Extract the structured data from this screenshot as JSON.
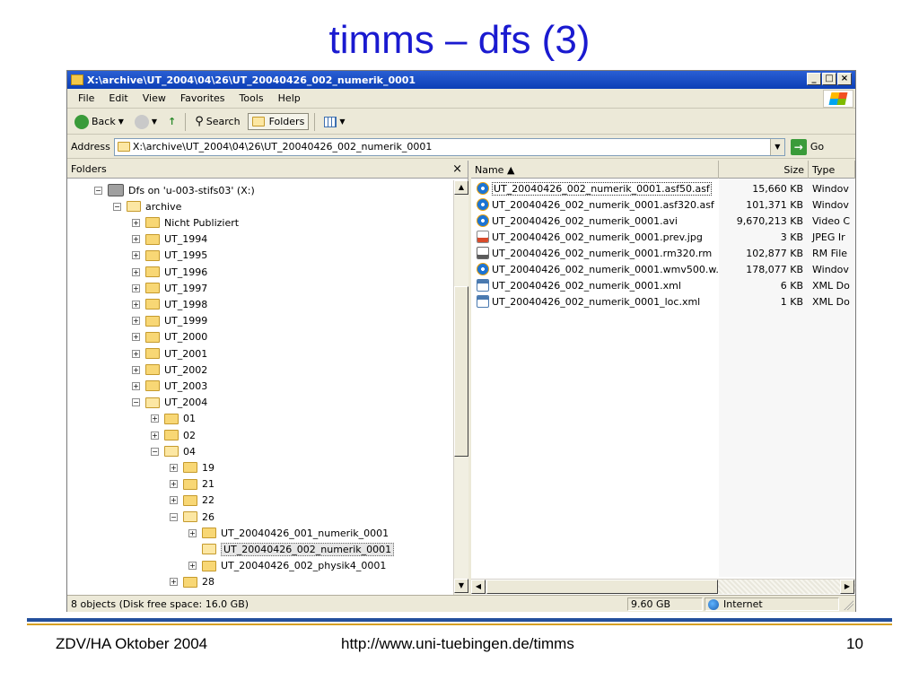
{
  "slide": {
    "title": "timms – dfs (3)",
    "footer_left": "ZDV/HA Oktober 2004",
    "footer_center": "http://www.uni-tuebingen.de/timms",
    "footer_right": "10"
  },
  "window": {
    "title": "X:\\archive\\UT_2004\\04\\26\\UT_20040426_002_numerik_0001",
    "controls": {
      "minimize": "_",
      "maximize": "□",
      "close": "×"
    }
  },
  "menu": [
    "File",
    "Edit",
    "View",
    "Favorites",
    "Tools",
    "Help"
  ],
  "toolbar": {
    "back": "Back",
    "search": "Search",
    "folders": "Folders"
  },
  "address": {
    "label": "Address",
    "value": "X:\\archive\\UT_2004\\04\\26\\UT_20040426_002_numerik_0001",
    "go": "Go"
  },
  "folders_pane": {
    "header": "Folders",
    "close": "×",
    "tree": [
      {
        "label": "Dfs on 'u-003-stifs03' (X:)",
        "level": 0,
        "expander": "−",
        "icon": "network-drive"
      },
      {
        "label": "archive",
        "level": 1,
        "expander": "−",
        "icon": "folder-open"
      },
      {
        "label": "Nicht Publiziert",
        "level": 2,
        "expander": "+",
        "icon": "folder"
      },
      {
        "label": "UT_1994",
        "level": 2,
        "expander": "+",
        "icon": "folder"
      },
      {
        "label": "UT_1995",
        "level": 2,
        "expander": "+",
        "icon": "folder"
      },
      {
        "label": "UT_1996",
        "level": 2,
        "expander": "+",
        "icon": "folder"
      },
      {
        "label": "UT_1997",
        "level": 2,
        "expander": "+",
        "icon": "folder"
      },
      {
        "label": "UT_1998",
        "level": 2,
        "expander": "+",
        "icon": "folder"
      },
      {
        "label": "UT_1999",
        "level": 2,
        "expander": "+",
        "icon": "folder"
      },
      {
        "label": "UT_2000",
        "level": 2,
        "expander": "+",
        "icon": "folder"
      },
      {
        "label": "UT_2001",
        "level": 2,
        "expander": "+",
        "icon": "folder"
      },
      {
        "label": "UT_2002",
        "level": 2,
        "expander": "+",
        "icon": "folder"
      },
      {
        "label": "UT_2003",
        "level": 2,
        "expander": "+",
        "icon": "folder"
      },
      {
        "label": "UT_2004",
        "level": 2,
        "expander": "−",
        "icon": "folder-open"
      },
      {
        "label": "01",
        "level": 3,
        "expander": "+",
        "icon": "folder"
      },
      {
        "label": "02",
        "level": 3,
        "expander": "+",
        "icon": "folder"
      },
      {
        "label": "04",
        "level": 3,
        "expander": "−",
        "icon": "folder-open"
      },
      {
        "label": "19",
        "level": 4,
        "expander": "+",
        "icon": "folder"
      },
      {
        "label": "21",
        "level": 4,
        "expander": "+",
        "icon": "folder"
      },
      {
        "label": "22",
        "level": 4,
        "expander": "+",
        "icon": "folder"
      },
      {
        "label": "26",
        "level": 4,
        "expander": "−",
        "icon": "folder-open"
      },
      {
        "label": "UT_20040426_001_numerik_0001",
        "level": 5,
        "expander": "+",
        "icon": "folder"
      },
      {
        "label": "UT_20040426_002_numerik_0001",
        "level": 5,
        "expander": "",
        "icon": "folder-open",
        "selected": true
      },
      {
        "label": "UT_20040426_002_physik4_0001",
        "level": 5,
        "expander": "+",
        "icon": "folder"
      },
      {
        "label": "28",
        "level": 4,
        "expander": "+",
        "icon": "folder"
      }
    ]
  },
  "files": {
    "columns": {
      "name": "Name ▲",
      "size": "Size",
      "type": "Type"
    },
    "rows": [
      {
        "name": "UT_20040426_002_numerik_0001.asf50.asf",
        "size": "15,660 KB",
        "type": "Windov",
        "icon": "media"
      },
      {
        "name": "UT_20040426_002_numerik_0001.asf320.asf",
        "size": "101,371 KB",
        "type": "Windov",
        "icon": "media"
      },
      {
        "name": "UT_20040426_002_numerik_0001.avi",
        "size": "9,670,213 KB",
        "type": "Video C",
        "icon": "media"
      },
      {
        "name": "UT_20040426_002_numerik_0001.prev.jpg",
        "size": "3 KB",
        "type": "JPEG Ir",
        "icon": "image"
      },
      {
        "name": "UT_20040426_002_numerik_0001.rm320.rm",
        "size": "102,877 KB",
        "type": "RM File",
        "icon": "realmedia"
      },
      {
        "name": "UT_20040426_002_numerik_0001.wmv500.w...",
        "size": "178,077 KB",
        "type": "Windov",
        "icon": "media"
      },
      {
        "name": "UT_20040426_002_numerik_0001.xml",
        "size": "6 KB",
        "type": "XML Do",
        "icon": "xml"
      },
      {
        "name": "UT_20040426_002_numerik_0001_loc.xml",
        "size": "1 KB",
        "type": "XML Do",
        "icon": "xml"
      }
    ]
  },
  "status": {
    "objects": "8 objects (Disk free space: 16.0 GB)",
    "size": "9.60 GB",
    "zone": "Internet"
  }
}
